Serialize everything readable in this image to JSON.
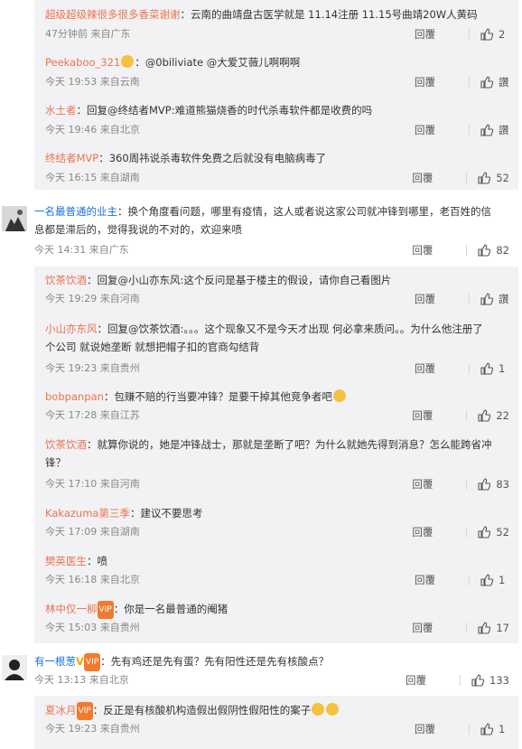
{
  "comments": [
    {
      "user": "超级超级辣很多很多香菜谢谢",
      "text": "：云南的曲靖盘古医学就是 11.14注册 11.15号曲靖20W人黄码",
      "time": "47分钟前",
      "loc": "来自广东",
      "reply": "回覆",
      "likes": "2"
    },
    {
      "user": "Peekaboo_321",
      "text": "：@0biliviate @大爱艾薇儿啊啊啊",
      "time": "今天 19:53",
      "loc": "来自云南",
      "reply": "回覆",
      "likes": "讚"
    },
    {
      "user": "水土者",
      "text": "：回复@终结者MVP:难道熊猫烧香的时代杀毒软件都是收费的吗",
      "time": "今天 19:46",
      "loc": "来自北京",
      "reply": "回覆",
      "likes": "讚"
    },
    {
      "user": "终结者MVP",
      "text": "：360周祎说杀毒软件免费之后就没有电脑病毒了",
      "time": "今天 16:15",
      "loc": "来自湖南",
      "reply": "回覆",
      "likes": "52"
    },
    {
      "user": "一名最普通的业主",
      "text": "：换个角度看问题，哪里有疫情，这人或者说这家公司就冲锋到哪里，老百姓的信息都是滞后的，觉得我说的不对的，欢迎来喷",
      "time": "今天 14:31",
      "loc": "来自广东",
      "reply": "回覆",
      "likes": "82"
    },
    {
      "user": "饮茶饮酒",
      "text": "：回复@小山亦东风:这个反问是基于楼主的假设，请你自己看图片",
      "time": "今天 19:29",
      "loc": "来自河南",
      "reply": "回覆",
      "likes": "讚"
    },
    {
      "user": "小山亦东风",
      "text": "：回复@饮茶饮酒:。。。这个现象又不是今天才出现 何必拿来质问。。为什么他注册了个公司 就说她垄断 就想把帽子扣的官商勾结背",
      "time": "今天 19:23",
      "loc": "来自贵州",
      "reply": "回覆",
      "likes": "1"
    },
    {
      "user": "bobpanpan",
      "text": "：包赚不赔的行当要冲锋？是要干掉其他竞争者吧",
      "time": "今天 17:28",
      "loc": "来自江苏",
      "reply": "回覆",
      "likes": "22"
    },
    {
      "user": "饮茶饮酒",
      "text": "：就算你说的，她是冲锋战士，那就是垄断了吧？为什么就她先得到消息？怎么能跨省冲锋？",
      "time": "今天 17:10",
      "loc": "来自河南",
      "reply": "回覆",
      "likes": "83"
    },
    {
      "user": "Kakazuma第三季",
      "text": "：建议不要思考",
      "time": "今天 17:09",
      "loc": "来自湖南",
      "reply": "回覆",
      "likes": "52"
    },
    {
      "user": "樊英医生",
      "text": "：喷",
      "time": "今天 16:18",
      "loc": "来自北京",
      "reply": "回覆",
      "likes": "1"
    },
    {
      "user": "林中仅一柳",
      "text": "：你是一名最普通的阉猪",
      "time": "今天 15:03",
      "loc": "来自贵州",
      "reply": "回覆",
      "likes": "17"
    },
    {
      "user": "有一根葱",
      "text": "：先有鸡还是先有蛋？先有阳性还是先有核酸点？",
      "time": "今天 13:13",
      "loc": "来自北京",
      "reply": "回覆",
      "likes": "133"
    },
    {
      "user": "夏冰月",
      "text": "：反正是有核酸机构造假出假阴性假阳性的案子",
      "time": "今天 19:23",
      "loc": "来自贵州",
      "reply": "回覆",
      "likes": "1"
    }
  ]
}
